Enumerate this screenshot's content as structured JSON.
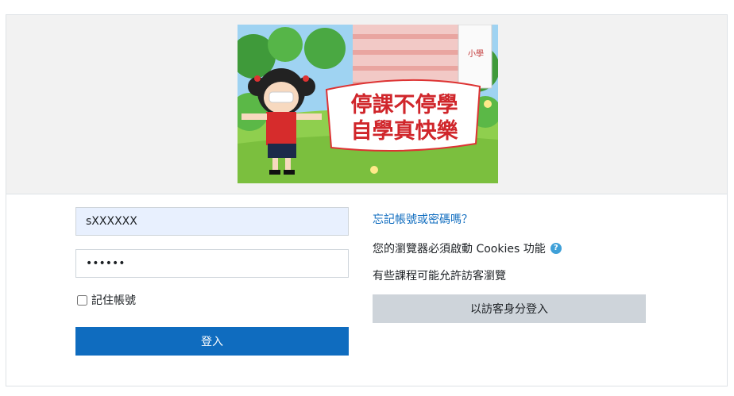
{
  "banner": {
    "line1": "停課不停學",
    "line2": "自學真快樂",
    "building_sign": "小學"
  },
  "login": {
    "username_value": "sXXXXXX",
    "password_value": "••••••",
    "remember_label": "記住帳號",
    "login_button": "登入"
  },
  "side": {
    "forgot_link": "忘記帳號或密碼嗎？",
    "cookies_text": "您的瀏覽器必須啟動 Cookies 功能",
    "help_icon": "?",
    "guests_text": "有些課程可能允許訪客瀏覽",
    "guest_button": "以訪客身分登入"
  },
  "colors": {
    "primary": "#0f6cbf",
    "secondary": "#ced4da",
    "autofill": "#e8f0fe"
  }
}
